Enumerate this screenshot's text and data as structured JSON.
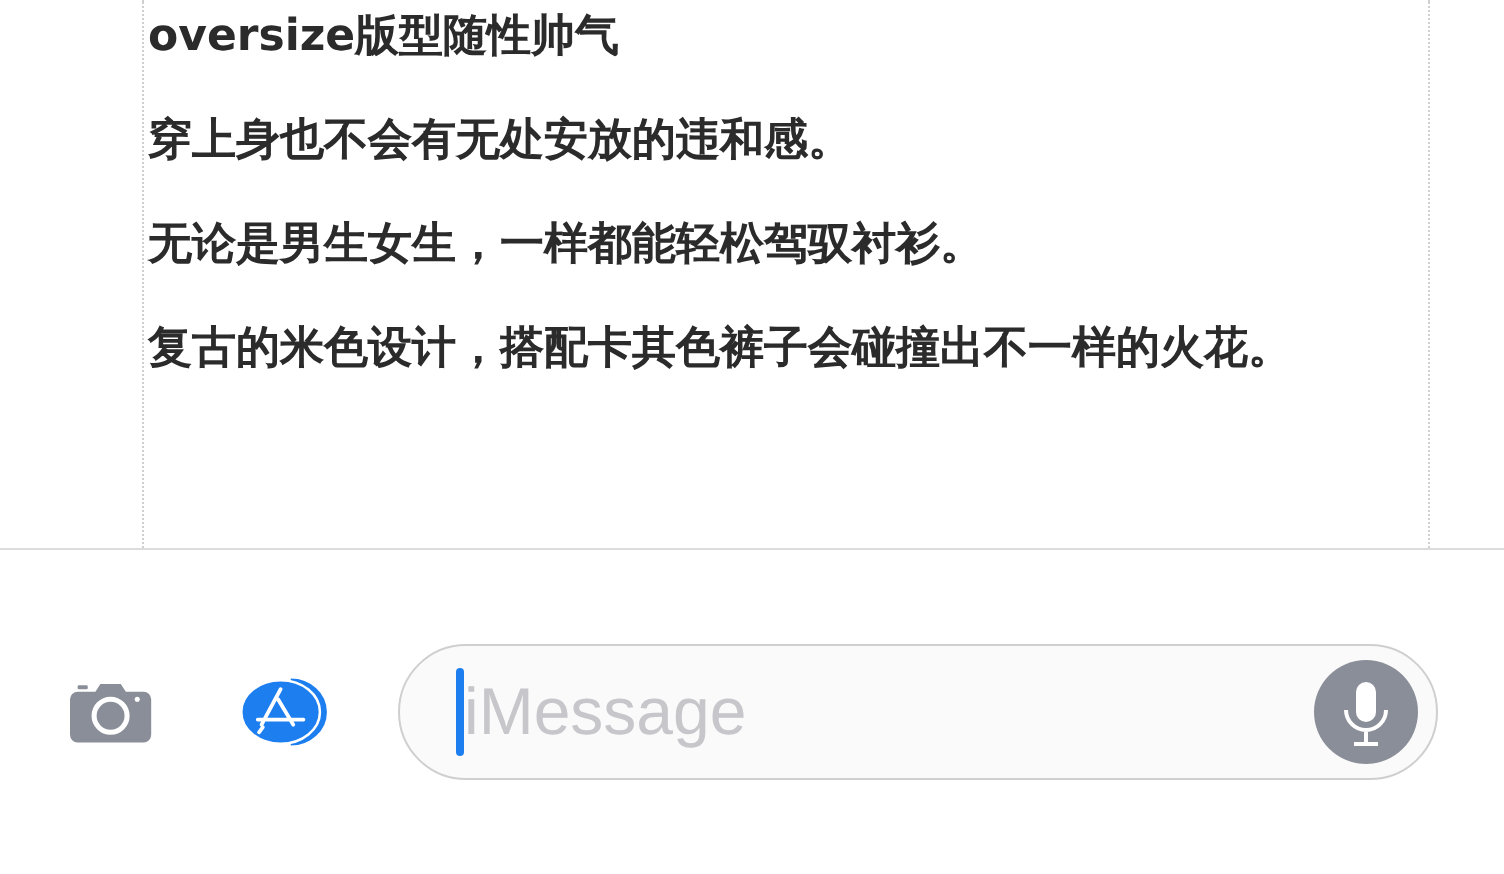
{
  "message_lines": [
    "oversize版型随性帅气",
    "穿上身也不会有无处安放的违和感。",
    "无论是男生女生，一样都能轻松驾驭衬衫。",
    "复古的米色设计，搭配卡其色裤子会碰撞出不一样的火花。"
  ],
  "input": {
    "placeholder": "iMessage"
  }
}
